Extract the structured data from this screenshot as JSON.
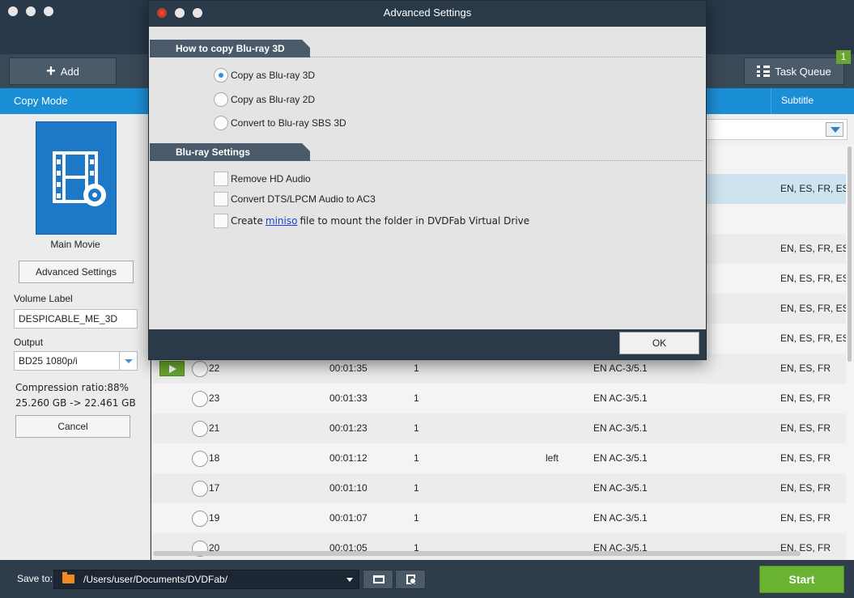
{
  "toolbar": {
    "add_label": "Add",
    "task_queue_label": "Task Queue",
    "task_queue_count": "1"
  },
  "left_panel": {
    "header": "Copy Mode",
    "mode_name": "Main Movie",
    "advanced_settings_label": "Advanced Settings",
    "volume_label_title": "Volume Label",
    "volume_label_value": "DESPICABLE_ME_3D",
    "output_title": "Output",
    "output_value": "BD25 1080p/i",
    "compression": "Compression ratio:88%",
    "size": "25.260 GB -> 22.461 GB",
    "cancel_label": "Cancel"
  },
  "content": {
    "subtitle_header": "Subtitle",
    "rows_above": [
      {
        "subtitle": "EN, ES, FR, ES,",
        "selected": true
      },
      {
        "subtitle": ""
      },
      {
        "subtitle": "EN, ES, FR, ES,"
      },
      {
        "subtitle": "EN, ES, FR, ES,"
      },
      {
        "subtitle": "EN, ES, FR, ES,"
      },
      {
        "subtitle": "EN, ES, FR, ES,"
      }
    ],
    "rows": [
      {
        "title": "22",
        "duration": "00:01:35",
        "chapters": "1",
        "angle": "",
        "audio": "EN  AC-3/5.1",
        "subtitle": "EN, ES, FR",
        "playing": true
      },
      {
        "title": "23",
        "duration": "00:01:33",
        "chapters": "1",
        "angle": "",
        "audio": "EN  AC-3/5.1",
        "subtitle": "EN, ES, FR"
      },
      {
        "title": "21",
        "duration": "00:01:23",
        "chapters": "1",
        "angle": "",
        "audio": "EN  AC-3/5.1",
        "subtitle": "EN, ES, FR"
      },
      {
        "title": "18",
        "duration": "00:01:12",
        "chapters": "1",
        "angle": "left",
        "audio": "EN  AC-3/5.1",
        "subtitle": "EN, ES, FR"
      },
      {
        "title": "17",
        "duration": "00:01:10",
        "chapters": "1",
        "angle": "",
        "audio": "EN  AC-3/5.1",
        "subtitle": "EN, ES, FR"
      },
      {
        "title": "19",
        "duration": "00:01:07",
        "chapters": "1",
        "angle": "",
        "audio": "EN  AC-3/5.1",
        "subtitle": "EN, ES, FR"
      },
      {
        "title": "20",
        "duration": "00:01:05",
        "chapters": "1",
        "angle": "",
        "audio": "EN  AC-3/5.1",
        "subtitle": "EN, ES, FR"
      }
    ]
  },
  "bottom": {
    "save_to_label": "Save to:",
    "path": "/Users/user/Documents/DVDFab/",
    "start_label": "Start"
  },
  "dialog": {
    "title": "Advanced Settings",
    "section1": "How to copy Blu-ray 3D",
    "options": [
      {
        "label": "Copy as Blu-ray 3D",
        "selected": true
      },
      {
        "label": "Copy as Blu-ray 2D",
        "selected": false
      },
      {
        "label": "Convert to Blu-ray SBS 3D",
        "selected": false
      }
    ],
    "section2": "Blu-ray Settings",
    "checks": [
      {
        "label": "Remove HD Audio",
        "checked": false
      },
      {
        "label": "Convert DTS/LPCM Audio to AC3",
        "checked": false
      }
    ],
    "miniso_prefix": "Create",
    "miniso_link": "miniso",
    "miniso_suffix": "file to mount the folder in DVDFab Virtual Drive",
    "ok_label": "OK"
  },
  "colors": {
    "accent_blue": "#1b8fd6",
    "start_green": "#6ab232",
    "dark_chrome": "#2b3a49"
  }
}
